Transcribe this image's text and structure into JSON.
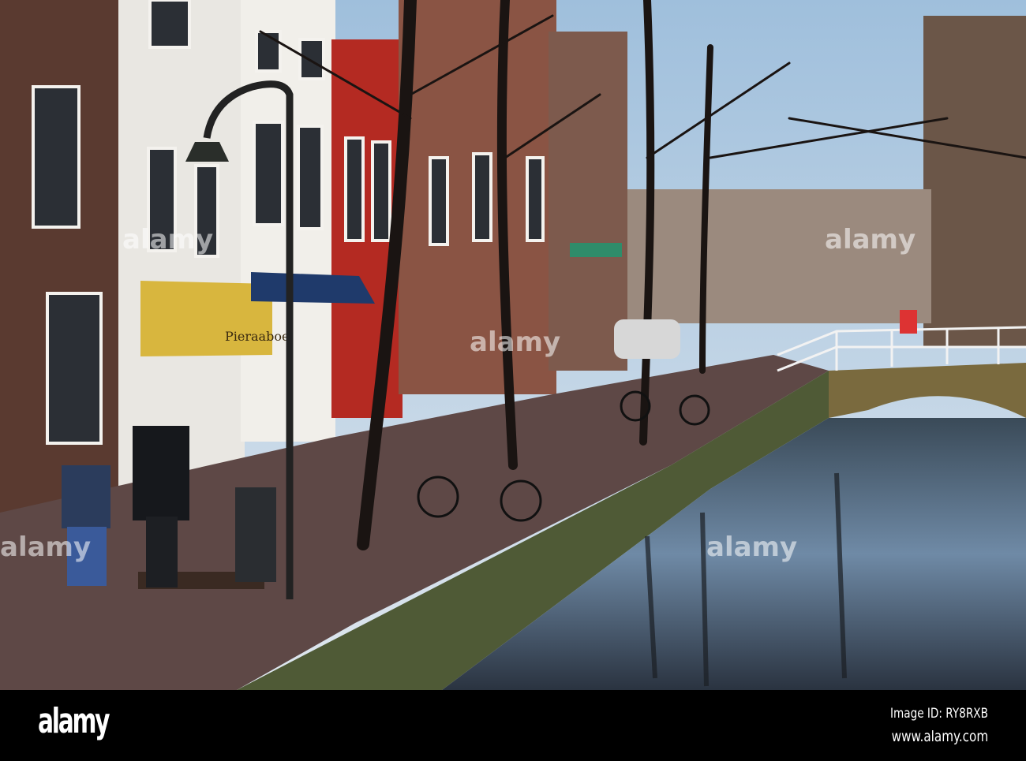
{
  "photo": {
    "shop_sign": "Pieraaboe",
    "watermark": "alamy"
  },
  "footer": {
    "logo": "alamy",
    "image_id": "Image ID: RY8RXB",
    "website": "www.alamy.com"
  }
}
